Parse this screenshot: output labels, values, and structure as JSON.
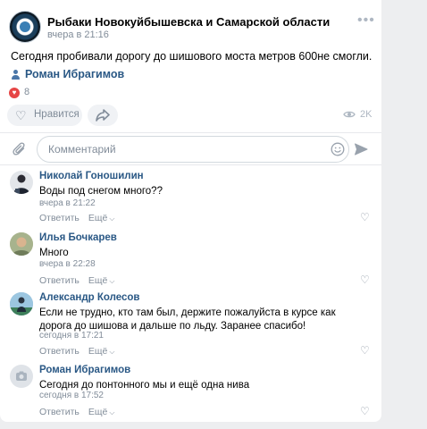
{
  "post": {
    "group_name": "Рыбаки Новокуйбышевска и Самарской области",
    "time": "вчера в 21:16",
    "text": "Сегодня пробивали дорогу до шишового моста метров 600не смогли.",
    "author": "Роман Ибрагимов",
    "reaction_count": "8",
    "like_label": "Нравится",
    "views": "2K"
  },
  "composer": {
    "placeholder": "Комментарий"
  },
  "comments": [
    {
      "name": "Николай Гоношилин",
      "text": "Воды под снегом много??",
      "time": "вчера в 21:22",
      "reply": "Ответить",
      "more": "Ещё"
    },
    {
      "name": "Илья Бочкарев",
      "text": "Много",
      "time": "вчера в 22:28",
      "reply": "Ответить",
      "more": "Ещё"
    },
    {
      "name": "Александр Колесов",
      "text": "Если не трудно, кто там был, держите пожалуйста в курсе как дорога до шишова и дальше по льду. Заранее спасибо!",
      "time": "сегодня в 17:21",
      "reply": "Ответить",
      "more": "Ещё"
    },
    {
      "name": "Роман Ибрагимов",
      "text": "Сегодня до понтонного мы и ещё одна нива",
      "time": "сегодня в 17:52",
      "reply": "Ответить",
      "more": "Ещё"
    }
  ],
  "colors": {
    "link": "#2a5885",
    "muted": "#818c99",
    "heart": "#e64646",
    "background": "#edeef0"
  },
  "icons": [
    "more-icon",
    "user-icon",
    "heart-icon",
    "share-icon",
    "eye-icon",
    "paperclip-icon",
    "smile-icon",
    "send-icon",
    "chevron-down-icon",
    "camera-icon"
  ]
}
